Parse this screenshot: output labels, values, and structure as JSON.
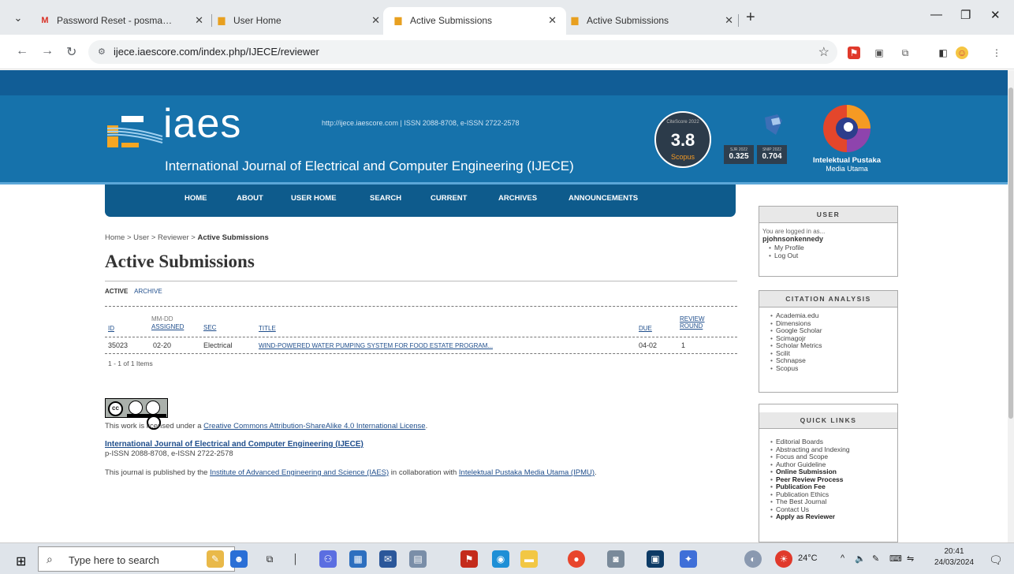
{
  "browser": {
    "tabs": [
      {
        "title": "Password Reset - posmahutaso",
        "icon": "gmail-icon",
        "active": false
      },
      {
        "title": "User Home",
        "icon": "ijece-favicon",
        "active": false
      },
      {
        "title": "Active Submissions",
        "icon": "ijece-favicon",
        "active": true
      },
      {
        "title": "Active Submissions",
        "icon": "ijece-favicon",
        "active": false
      }
    ],
    "url": "ijece.iaescore.com/index.php/IJECE/reviewer"
  },
  "header": {
    "logo_text": "iaes",
    "url_issn": "http://ijece.iaescore.com  |  ISSN 2088-8708, e-ISSN 2722-2578",
    "journal_title": "International Journal of Electrical and Computer Engineering (IJECE)",
    "citescore_label": "CiteScore 2022",
    "citescore": "3.8",
    "scopus": "Scopus",
    "sjr_label": "SJR 2022",
    "sjr": "0.325",
    "snip_label": "SNIP 2022",
    "snip": "0.704",
    "publisher": "Intelektual Pustaka",
    "publisher_sub": "Media Utama"
  },
  "nav": [
    "HOME",
    "ABOUT",
    "USER HOME",
    "SEARCH",
    "CURRENT",
    "ARCHIVES",
    "ANNOUNCEMENTS"
  ],
  "breadcrumb": {
    "path": "Home > User > Reviewer > ",
    "current": "Active Submissions"
  },
  "page_title": "Active Submissions",
  "subtabs": {
    "active": "ACTIVE",
    "archive": "ARCHIVE"
  },
  "table": {
    "headers": {
      "id": "ID",
      "mmdd": "MM-DD",
      "assigned": "ASSIGNED",
      "sec": "SEC",
      "title": "TITLE",
      "due": "DUE",
      "review": "REVIEW",
      "round": "ROUND"
    },
    "rows": [
      {
        "id": "35023",
        "assigned": "02-20",
        "sec": "Electrical",
        "title": "WIND-POWERED WATER PUMPING SYSTEM FOR FOOD ESTATE PROGRAM...",
        "due": "04-02",
        "round": "1"
      }
    ],
    "count": "1 - 1 of 1 Items"
  },
  "footer": {
    "cc_by": "BY",
    "cc_sa": "SA",
    "license_prefix": "This work is licensed under a ",
    "license_link": "Creative Commons Attribution-ShareAlike 4.0 International License",
    "license_suffix": ".",
    "journal_link": "International Journal of Electrical and Computer Engineering (IJECE)",
    "issn": "p-ISSN 2088-8708, e-ISSN 2722-2578",
    "pub_prefix": "This journal is published by the ",
    "pub_link1": "Institute of Advanced Engineering and Science (IAES)",
    "pub_mid": " in collaboration with ",
    "pub_link2": "Intelektual Pustaka Media Utama (IPMU)",
    "pub_suffix": "."
  },
  "sidebar": {
    "user": {
      "heading": "USER",
      "logged_text": "You are logged in as...",
      "username": "pjohnsonkennedy",
      "links": [
        "My Profile",
        "Log Out"
      ]
    },
    "citation": {
      "heading": "CITATION ANALYSIS",
      "links": [
        "Academia.edu",
        "Dimensions",
        "Google Scholar",
        "Scimagojr",
        "Scholar Metrics",
        "Scilit",
        "Schnapse",
        "Scopus"
      ]
    },
    "quick": {
      "heading": "QUICK LINKS",
      "links": [
        "Editorial Boards",
        "Abstracting and Indexing",
        "Focus and Scope",
        "Author Guideline",
        "Online Submission",
        "Peer Review Process",
        "Publication Fee",
        "Publication Ethics",
        "The Best Journal",
        "Contact Us",
        "Apply as Reviewer"
      ]
    }
  },
  "taskbar": {
    "search_placeholder": "Type here to search",
    "weather": "24°C",
    "time": "20:41",
    "date": "24/03/2024"
  }
}
